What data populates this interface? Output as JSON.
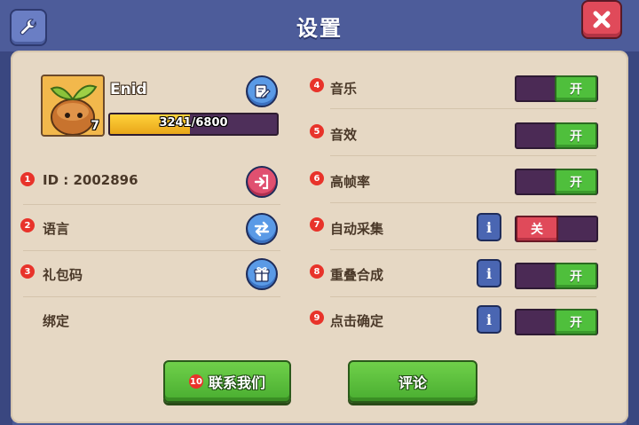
{
  "header": {
    "title": "设置"
  },
  "profile": {
    "name": "Enid",
    "level": "7",
    "xp_text": "3241/6800",
    "xp_progress": 0.477
  },
  "left_rows": [
    {
      "badge": "1",
      "label": "ID : 2002896"
    },
    {
      "badge": "2",
      "label": "语言"
    },
    {
      "badge": "3",
      "label": "礼包码"
    },
    {
      "badge": "",
      "label": "绑定"
    }
  ],
  "settings": [
    {
      "badge": "4",
      "label": "音乐",
      "state": "开",
      "on": true,
      "info": false
    },
    {
      "badge": "5",
      "label": "音效",
      "state": "开",
      "on": true,
      "info": false
    },
    {
      "badge": "6",
      "label": "高帧率",
      "state": "开",
      "on": true,
      "info": false
    },
    {
      "badge": "7",
      "label": "自动采集",
      "state": "关",
      "on": false,
      "info": true
    },
    {
      "badge": "8",
      "label": "重叠合成",
      "state": "开",
      "on": true,
      "info": true
    },
    {
      "badge": "9",
      "label": "点击确定",
      "state": "开",
      "on": true,
      "info": true
    }
  ],
  "buttons": {
    "contact_badge": "10",
    "contact": "联系我们",
    "review": "评论"
  },
  "info_glyph": "i",
  "colors": {
    "toggle_on": "#4fbf3c",
    "toggle_off": "#e04a5a",
    "toggle_track": "#4b2a55",
    "badge": "#e8332a",
    "panel": "#e6d8c4"
  },
  "icons": {
    "settings": "wrench-icon",
    "close": "close-x-icon",
    "edit": "edit-icon",
    "logout": "logout-icon",
    "language": "swap-arrows-icon",
    "gift": "gift-icon"
  }
}
